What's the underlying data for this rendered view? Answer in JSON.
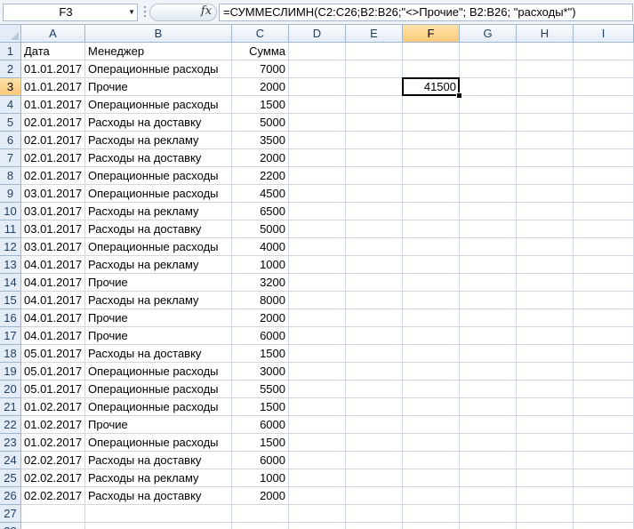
{
  "name_box": "F3",
  "formula_icon": "fx-icon",
  "formula": "=СУММЕСЛИМН(C2:C26;B2:B26;\"<>Прочие\"; B2:B26; \"расходы*\")",
  "active_cell": {
    "col": "F",
    "row": 3
  },
  "columns": [
    "A",
    "B",
    "C",
    "D",
    "E",
    "F",
    "G",
    "H",
    "I"
  ],
  "rows": [
    [
      "Дата",
      "Менеджер",
      "Сумма",
      "",
      "",
      "",
      "",
      "",
      ""
    ],
    [
      "01.01.2017",
      "Операционные расходы",
      "7000",
      "",
      "",
      "",
      "",
      "",
      ""
    ],
    [
      "01.01.2017",
      "Прочие",
      "2000",
      "",
      "",
      "41500",
      "",
      "",
      ""
    ],
    [
      "01.01.2017",
      "Операционные расходы",
      "1500",
      "",
      "",
      "",
      "",
      "",
      ""
    ],
    [
      "02.01.2017",
      "Расходы на доставку",
      "5000",
      "",
      "",
      "",
      "",
      "",
      ""
    ],
    [
      "02.01.2017",
      "Расходы на рекламу",
      "3500",
      "",
      "",
      "",
      "",
      "",
      ""
    ],
    [
      "02.01.2017",
      "Расходы на доставку",
      "2000",
      "",
      "",
      "",
      "",
      "",
      ""
    ],
    [
      "02.01.2017",
      "Операционные расходы",
      "2200",
      "",
      "",
      "",
      "",
      "",
      ""
    ],
    [
      "03.01.2017",
      "Операционные расходы",
      "4500",
      "",
      "",
      "",
      "",
      "",
      ""
    ],
    [
      "03.01.2017",
      "Расходы на рекламу",
      "6500",
      "",
      "",
      "",
      "",
      "",
      ""
    ],
    [
      "03.01.2017",
      "Расходы на доставку",
      "5000",
      "",
      "",
      "",
      "",
      "",
      ""
    ],
    [
      "03.01.2017",
      "Операционные расходы",
      "4000",
      "",
      "",
      "",
      "",
      "",
      ""
    ],
    [
      "04.01.2017",
      "Расходы на рекламу",
      "1000",
      "",
      "",
      "",
      "",
      "",
      ""
    ],
    [
      "04.01.2017",
      "Прочие",
      "3200",
      "",
      "",
      "",
      "",
      "",
      ""
    ],
    [
      "04.01.2017",
      "Расходы на рекламу",
      "8000",
      "",
      "",
      "",
      "",
      "",
      ""
    ],
    [
      "04.01.2017",
      "Прочие",
      "2000",
      "",
      "",
      "",
      "",
      "",
      ""
    ],
    [
      "04.01.2017",
      "Прочие",
      "6000",
      "",
      "",
      "",
      "",
      "",
      ""
    ],
    [
      "05.01.2017",
      "Расходы на доставку",
      "1500",
      "",
      "",
      "",
      "",
      "",
      ""
    ],
    [
      "05.01.2017",
      "Операционные расходы",
      "3000",
      "",
      "",
      "",
      "",
      "",
      ""
    ],
    [
      "05.01.2017",
      "Операционные расходы",
      "5500",
      "",
      "",
      "",
      "",
      "",
      ""
    ],
    [
      "01.02.2017",
      "Операционные расходы",
      "1500",
      "",
      "",
      "",
      "",
      "",
      ""
    ],
    [
      "01.02.2017",
      "Прочие",
      "6000",
      "",
      "",
      "",
      "",
      "",
      ""
    ],
    [
      "01.02.2017",
      "Операционные расходы",
      "1500",
      "",
      "",
      "",
      "",
      "",
      ""
    ],
    [
      "02.02.2017",
      "Расходы на доставку",
      "6000",
      "",
      "",
      "",
      "",
      "",
      ""
    ],
    [
      "02.02.2017",
      "Расходы на рекламу",
      "1000",
      "",
      "",
      "",
      "",
      "",
      ""
    ],
    [
      "02.02.2017",
      "Расходы на доставку",
      "2000",
      "",
      "",
      "",
      "",
      "",
      ""
    ],
    [
      "",
      "",
      "",
      "",
      "",
      "",
      "",
      "",
      ""
    ],
    [
      "",
      "",
      "",
      "",
      "",
      "",
      "",
      "",
      ""
    ]
  ]
}
